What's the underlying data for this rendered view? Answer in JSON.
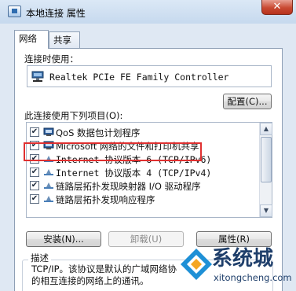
{
  "window": {
    "title": "本地连接 属性",
    "close_glyph": "✕"
  },
  "tabs": [
    {
      "label": "网络",
      "active": true
    },
    {
      "label": "共享",
      "active": false
    }
  ],
  "connect_using_label": "连接时使用：",
  "adapter_name": "Realtek PCIe FE Family Controller",
  "configure_button": "配置(C)...",
  "items_label": "此连接使用下列项目(O):",
  "items": [
    {
      "label": "QoS 数据包计划程序",
      "checked": true,
      "icon": "qos-icon",
      "mono": false
    },
    {
      "label": "Microsoft 网络的文件和打印机共享",
      "checked": true,
      "icon": "network-client-icon",
      "mono": false
    },
    {
      "label": "Internet 协议版本 6 (TCP/IPv6)",
      "checked": true,
      "icon": "protocol-icon",
      "mono": true
    },
    {
      "label": "Internet 协议版本 4 (TCP/IPv4)",
      "checked": true,
      "icon": "protocol-icon",
      "mono": true
    },
    {
      "label": "链路层拓扑发现映射器 I/O 驱动程序",
      "checked": true,
      "icon": "protocol-icon",
      "mono": false
    },
    {
      "label": "链路层拓扑发现响应程序",
      "checked": true,
      "icon": "protocol-icon",
      "mono": false
    }
  ],
  "check_glyph": "✔",
  "buttons": {
    "install": "安装(N)...",
    "uninstall": "卸载(U)",
    "properties": "属性(R)"
  },
  "description": {
    "title": "描述",
    "line1": "TCP/IP。该协议是默认的广域网络协",
    "line2": "的相互连接的网络上的通讯。"
  },
  "watermark": {
    "brand": "系统城",
    "site": "xitongcheng.com"
  },
  "colors": {
    "highlight": "#e03030",
    "close_button": "#c94a32",
    "window_frame": "#dfe8f3"
  }
}
